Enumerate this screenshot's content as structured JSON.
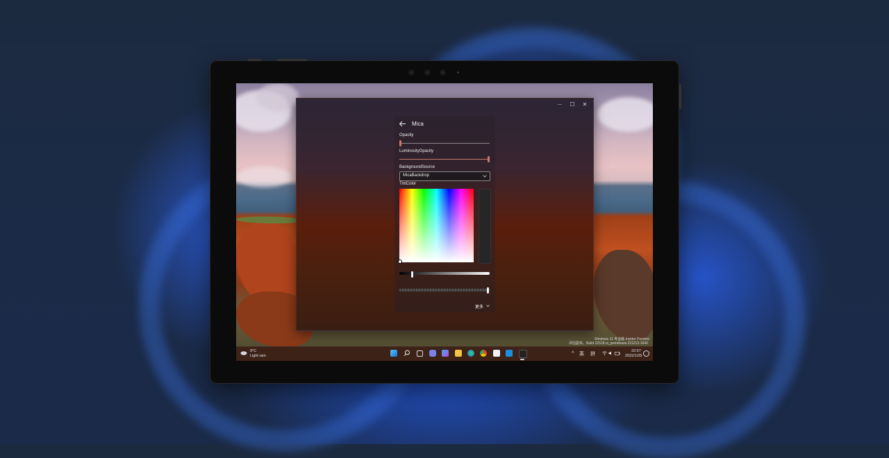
{
  "app": {
    "title": "Mica",
    "caption": {
      "minimize": "—",
      "maximize": "☐",
      "close": "✕"
    }
  },
  "settings": {
    "opacity_label": "Opacity",
    "opacity_value": 0.0,
    "luminosity_label": "LuminosityOpacity",
    "luminosity_value": 1.0,
    "background_source_label": "BackgroundSource",
    "background_source_value": "MicaBackdrop",
    "tint_color_label": "TintColor",
    "more_label": "更多"
  },
  "desktop": {
    "watermark_line1": "Windows 11 专业版 Insider Preview",
    "watermark_line2": "评估副本。Build 22518.rs_prerelease.211213-1640"
  },
  "taskbar": {
    "weather_temp": "9°C",
    "weather_desc": "Light rain",
    "tray_chevron": "^",
    "ime_lang": "英",
    "ime_mode": "拼",
    "time": "22:57",
    "date": "2022/1/25"
  },
  "icons": [
    "back-arrow-icon",
    "chevron-down-icon",
    "start-icon",
    "search-icon",
    "task-view-icon",
    "teams-chat-icon",
    "widgets-icon",
    "file-explorer-icon",
    "edge-icon",
    "chrome-icon",
    "store-icon",
    "mail-icon",
    "app-icon",
    "weather-icon",
    "wifi-icon",
    "volume-icon",
    "battery-icon",
    "notification-icon"
  ]
}
